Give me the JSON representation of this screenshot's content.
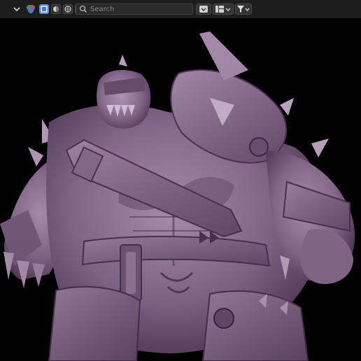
{
  "toolbar": {
    "search": {
      "placeholder": "Search",
      "value": ""
    },
    "icons": {
      "view_dropdown": "chevron-down-icon",
      "display_modes": [
        "object-mode-icon",
        "solid-shading-icon",
        "material-shading-icon",
        "rendered-shading-icon",
        "wireframe-shading-icon",
        "xray-shading-icon"
      ],
      "viewport_shading": "shading-dropdown-icon",
      "view_layout": "view-layout-icon",
      "filter": "filter-icon"
    },
    "accent_color": "#4a78c8"
  },
  "viewport": {
    "subject": "sculpted-orc-warrior-model",
    "model_color": "#9b7aa1",
    "background_color": "#000000"
  }
}
